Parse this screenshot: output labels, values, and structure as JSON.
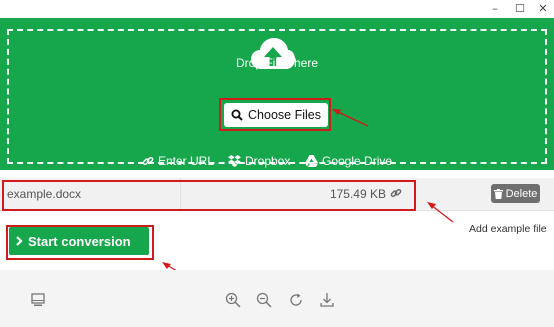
{
  "window": {
    "controls": {
      "minimize": "–",
      "maximize": "☐",
      "close": "✕"
    }
  },
  "drop_zone": {
    "title": "Drop Files here",
    "choose_button": "Choose Files",
    "sources": [
      {
        "label": "Enter URL",
        "icon": "link-icon"
      },
      {
        "label": "Dropbox",
        "icon": "dropbox-icon"
      },
      {
        "label": "Google Drive",
        "icon": "google-drive-icon"
      }
    ],
    "background_color": "#16a64b"
  },
  "file": {
    "name": "example.docx",
    "size": "175.49 KB",
    "delete_label": "Delete"
  },
  "annotation": {
    "add_example": "Add example file",
    "highlight_color": "#d11a1a"
  },
  "start_button": {
    "label": "Start conversion",
    "icon": "chevron-right-icon"
  },
  "toolbar": {
    "icons": [
      "monitor-icon",
      "zoom-in-icon",
      "zoom-out-icon",
      "refresh-icon",
      "download-icon"
    ]
  }
}
